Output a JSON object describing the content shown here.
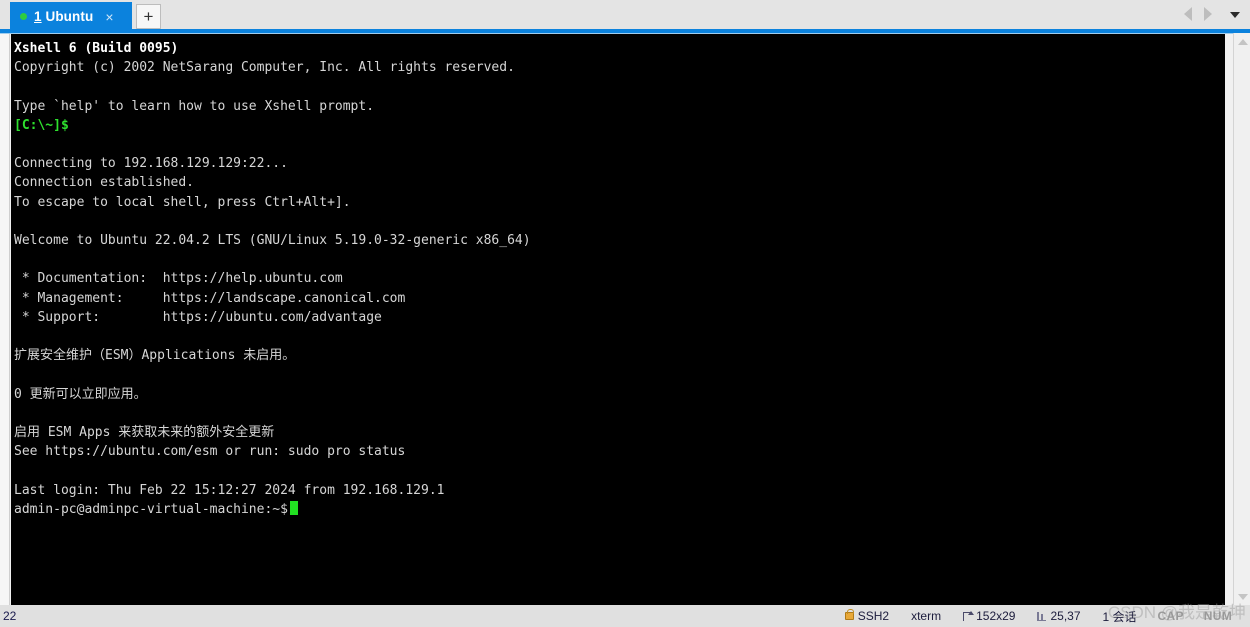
{
  "window": {
    "tabs": [
      {
        "index": "1",
        "title": "Ubuntu",
        "close_label": "×",
        "dot": "active-indicator-dot"
      }
    ],
    "new_tab_label": "+",
    "nav": {
      "prev": "scroll-tabs-left",
      "next": "scroll-tabs-right",
      "menu": "tab-list-dropdown"
    },
    "accent_color": "#0b82dd",
    "tabbar_bg": "#e4e4e4"
  },
  "terminal": {
    "background": "#000000",
    "foreground": "#d6d6d6",
    "prompt_color": "#2ee02e",
    "cursor_color": "#22e022",
    "lines": [
      {
        "text": "Xshell 6 (Build 0095)",
        "style": "bold"
      },
      {
        "text": "Copyright (c) 2002 NetSarang Computer, Inc. All rights reserved.",
        "style": "normal"
      },
      {
        "text": "",
        "style": "blank"
      },
      {
        "text": "Type `help' to learn how to use Xshell prompt.",
        "style": "normal"
      },
      {
        "text": "[C:\\~]$",
        "style": "green"
      },
      {
        "text": "",
        "style": "blank"
      },
      {
        "text": "Connecting to 192.168.129.129:22...",
        "style": "normal"
      },
      {
        "text": "Connection established.",
        "style": "normal"
      },
      {
        "text": "To escape to local shell, press Ctrl+Alt+].",
        "style": "normal"
      },
      {
        "text": "",
        "style": "blank"
      },
      {
        "text": "Welcome to Ubuntu 22.04.2 LTS (GNU/Linux 5.19.0-32-generic x86_64)",
        "style": "normal"
      },
      {
        "text": "",
        "style": "blank"
      },
      {
        "text": " * Documentation:  https://help.ubuntu.com",
        "style": "normal"
      },
      {
        "text": " * Management:     https://landscape.canonical.com",
        "style": "normal"
      },
      {
        "text": " * Support:        https://ubuntu.com/advantage",
        "style": "normal"
      },
      {
        "text": "",
        "style": "blank"
      },
      {
        "text": "扩展安全维护（ESM）Applications 未启用。",
        "style": "normal"
      },
      {
        "text": "",
        "style": "blank"
      },
      {
        "text": "0 更新可以立即应用。",
        "style": "normal"
      },
      {
        "text": "",
        "style": "blank"
      },
      {
        "text": "启用 ESM Apps 来获取未来的额外安全更新",
        "style": "normal"
      },
      {
        "text": "See https://ubuntu.com/esm or run: sudo pro status",
        "style": "normal"
      },
      {
        "text": "",
        "style": "blank"
      },
      {
        "text": "Last login: Thu Feb 22 15:12:27 2024 from 192.168.129.1",
        "style": "normal"
      }
    ],
    "prompt": {
      "text": "admin-pc@adminpc-virtual-machine:~$",
      "style": "normal"
    }
  },
  "statusbar": {
    "left": "22",
    "protocol": "SSH2",
    "terminal_type": "xterm",
    "size": "152x29",
    "cursor_position": "25,37",
    "sessions": "1 会话",
    "caps": "CAP",
    "num": "NUM",
    "watermark": "CSDN @我是乾坤"
  }
}
